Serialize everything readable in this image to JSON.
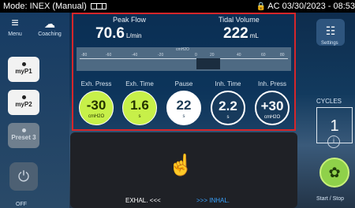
{
  "status_bar": {
    "mode": "Mode: INEX (Manual)",
    "right_text": "AC 03/30/2023 - 08:53"
  },
  "left_panel": {
    "menu_label": "Menu",
    "coaching_label": "Coaching",
    "presets": [
      "myP1",
      "myP2",
      "Preset 3"
    ],
    "off_label": "OFF"
  },
  "metrics": {
    "peak_flow": {
      "label": "Peak Flow",
      "value": "70.6",
      "unit": "L/min"
    },
    "tidal_volume": {
      "label": "Tidal Volume",
      "value": "222",
      "unit": "mL"
    }
  },
  "pressure_scale": {
    "unit": "cmH2O",
    "ticks": [
      "-80",
      "-60",
      "-40",
      "-20",
      "0",
      "20",
      "40",
      "60",
      "80"
    ],
    "bar_level": "0 to 20"
  },
  "parameters": [
    {
      "label": "Exh. Press",
      "value": "-30",
      "unit": "cmH2O",
      "style": "green"
    },
    {
      "label": "Exh. Time",
      "value": "1.6",
      "unit": "s",
      "style": "green"
    },
    {
      "label": "Pause",
      "value": "22",
      "unit": "s",
      "style": "white"
    },
    {
      "label": "Inh. Time",
      "value": "2.2",
      "unit": "s",
      "style": "dark"
    },
    {
      "label": "Inh. Press",
      "value": "+30",
      "unit": "cmH2O",
      "style": "dark"
    }
  ],
  "info_panel": {
    "exhal_text": "EXHAL. <<<",
    "inhal_text": ">>> INHAL."
  },
  "right_panel": {
    "settings_label": "Settings",
    "cycles_label": "CYCLES",
    "cycles_value": "1",
    "start_label": "Start / Stop"
  },
  "icons": [
    "battery-icon",
    "lock-icon",
    "menu-icon",
    "coaching-icon",
    "power-icon",
    "touch-icon",
    "settings-icon",
    "info-icon",
    "fan-icon"
  ]
}
